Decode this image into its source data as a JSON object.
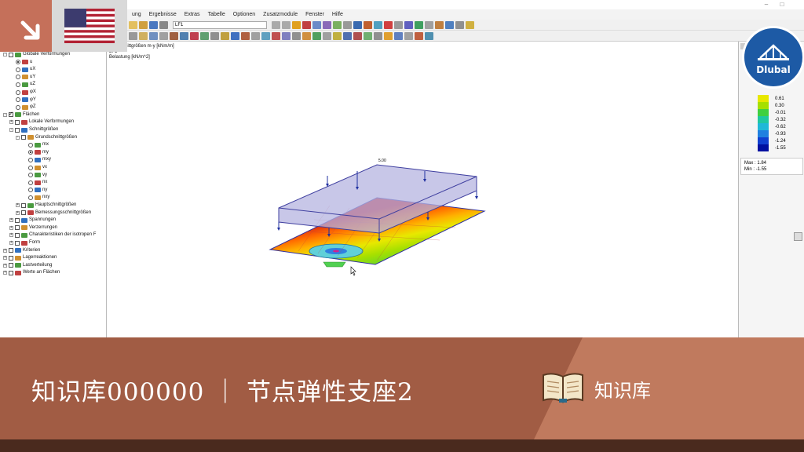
{
  "window": {
    "minimize": "–",
    "maximize": "□"
  },
  "menu": [
    "ung",
    "Ergebnisse",
    "Extras",
    "Tabelle",
    "Optionen",
    "Zusatzmodule",
    "Fenster",
    "Hilfe"
  ],
  "toolbar": {
    "loadcase": "LF1"
  },
  "navigator": {
    "items": [
      {
        "label": "Globale Verformungen",
        "level": 0,
        "exp": "-",
        "check": "box"
      },
      {
        "label": "u",
        "level": 2,
        "check": "radio-on"
      },
      {
        "label": "uX",
        "level": 2,
        "check": "radio"
      },
      {
        "label": "uY",
        "level": 2,
        "check": "radio"
      },
      {
        "label": "uZ",
        "level": 2,
        "check": "radio"
      },
      {
        "label": "φX",
        "level": 2,
        "check": "radio"
      },
      {
        "label": "φY",
        "level": 2,
        "check": "radio"
      },
      {
        "label": "φZ",
        "level": 2,
        "check": "radio"
      },
      {
        "label": "Flächen",
        "level": 0,
        "exp": "-",
        "check": "box-on"
      },
      {
        "label": "Lokale Verformungen",
        "level": 1,
        "exp": "+",
        "check": "box"
      },
      {
        "label": "Schnittgrößen",
        "level": 1,
        "exp": "-",
        "check": "box"
      },
      {
        "label": "Grundschnittgrößen",
        "level": 2,
        "exp": "-",
        "check": "box"
      },
      {
        "label": "mx",
        "level": 4,
        "check": "radio"
      },
      {
        "label": "my",
        "level": 4,
        "check": "radio-on"
      },
      {
        "label": "mxy",
        "level": 4,
        "check": "radio"
      },
      {
        "label": "vx",
        "level": 4,
        "check": "radio"
      },
      {
        "label": "vy",
        "level": 4,
        "check": "radio"
      },
      {
        "label": "nx",
        "level": 4,
        "check": "radio"
      },
      {
        "label": "ny",
        "level": 4,
        "check": "radio"
      },
      {
        "label": "nxy",
        "level": 4,
        "check": "radio"
      },
      {
        "label": "Hauptschnittgrößen",
        "level": 2,
        "exp": "+",
        "check": "box"
      },
      {
        "label": "Bemessungsschnittgrößen",
        "level": 2,
        "exp": "+",
        "check": "box"
      },
      {
        "label": "Spannungen",
        "level": 1,
        "exp": "+",
        "check": "box"
      },
      {
        "label": "Verzerrungen",
        "level": 1,
        "exp": "+",
        "check": "box"
      },
      {
        "label": "Charakteristiken der isotropen F",
        "level": 1,
        "exp": "+",
        "check": "box"
      },
      {
        "label": "Form",
        "level": 1,
        "exp": "+",
        "check": "box"
      },
      {
        "label": "Kriterien",
        "level": 0,
        "exp": "+",
        "check": "box"
      },
      {
        "label": "Lagerreaktionen",
        "level": 0,
        "exp": "+",
        "check": "box"
      },
      {
        "label": "Lastverteilung",
        "level": 0,
        "exp": "+",
        "check": "box"
      },
      {
        "label": "Werte an Flächen",
        "level": 0,
        "exp": "+",
        "check": "box"
      }
    ]
  },
  "view": {
    "line1": "LF1",
    "line2": "Belastung [kN/m^2]",
    "header_partial": "nittgrößen m-y [kNm/m]",
    "load_value": "5.00"
  },
  "panel": {
    "legend": [
      {
        "value": "0.61",
        "color": "#e8e800"
      },
      {
        "value": "0.30",
        "color": "#a6e000"
      },
      {
        "value": "-0.01",
        "color": "#40d040"
      },
      {
        "value": "-0.32",
        "color": "#20c8a0"
      },
      {
        "value": "-0.62",
        "color": "#20b8d8"
      },
      {
        "value": "-0.93",
        "color": "#2080e0"
      },
      {
        "value": "-1.24",
        "color": "#1040d0"
      },
      {
        "value": "-1.55",
        "color": "#0010a0"
      }
    ],
    "max_label": "Max :",
    "max_value": "1.84",
    "min_label": "Min :",
    "min_value": "-1.55"
  },
  "logo": {
    "text": "Dlubal"
  },
  "banner": {
    "title": "知识库000000 ｜ 节点弹性支座2",
    "tag": "知识库"
  }
}
